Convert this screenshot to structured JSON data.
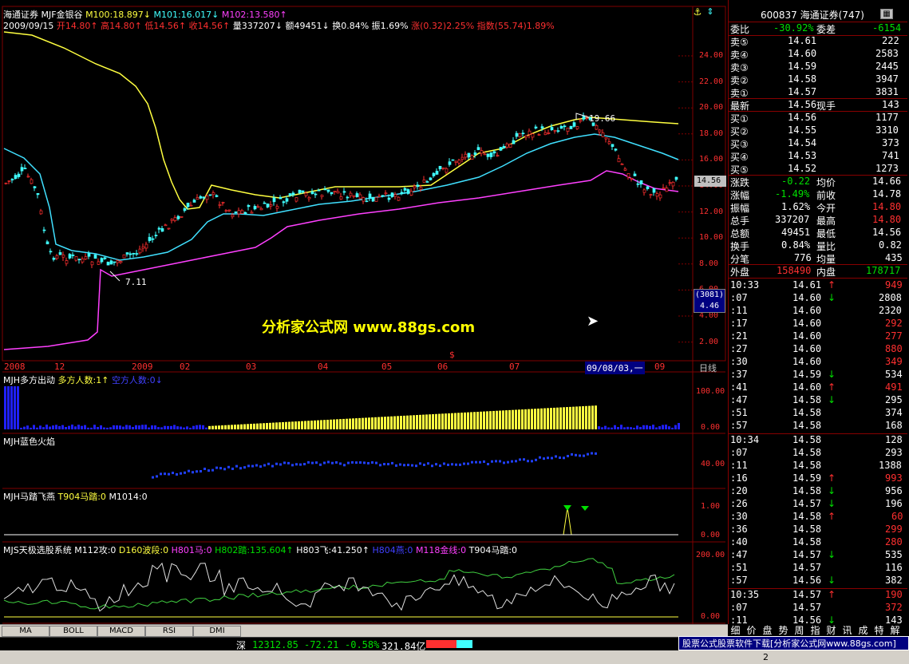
{
  "header": {
    "stock_name": "海通证券",
    "formula": "MJF金银谷",
    "m100": "M100:18.897↓",
    "m101": "M101:16.017↓",
    "m102": "M102:13.580↑",
    "line2_date": "2009/09/15",
    "open": "开14.80↑",
    "high": "高14.80↑",
    "low": "低14.56↑",
    "close": "收14.56↑",
    "volume": "量337207↓",
    "amount": "额49451↓",
    "turnover": "换0.84%",
    "amplitude": "振1.69%",
    "change": "涨(0.32)2.25%",
    "index": "指数(55.74)1.89%"
  },
  "price_axis": [
    "24.00",
    "22.00",
    "20.00",
    "18.00",
    "16.00",
    "14.00",
    "12.00",
    "10.00",
    "8.00",
    "6.00",
    "4.00",
    "2.00"
  ],
  "price_tag": "14.56",
  "index_box": [
    "(3081)",
    "4.46"
  ],
  "chart_labels": {
    "high_label": "19.66",
    "low_label": "7.11",
    "watermark": "分析家公式网 www.88gs.com",
    "s_marker": "$"
  },
  "date_axis": [
    "2008",
    "12",
    "2009",
    "02",
    "03",
    "04",
    "05",
    "06",
    "07",
    "09/08/03,一",
    "09",
    "日线"
  ],
  "panel2": {
    "title": "MJH多方出动",
    "long_count": "多方人数:1↑",
    "short_count": "空方人数:0↓",
    "axis": [
      "100.00",
      "0.00"
    ]
  },
  "panel3": {
    "title": "MJH蓝色火焰",
    "axis": [
      "40.00"
    ]
  },
  "panel4": {
    "title": "MJH马踏飞燕",
    "t904": "T904马踏:0",
    "m1014": "M1014:0",
    "axis": [
      "1.00",
      "0.00"
    ]
  },
  "panel5": {
    "title": "MJS天极选股系统",
    "m112": "M112攻:0",
    "d160": "D160波段:0",
    "h801": "H801马:0",
    "h802": "H802踏:135.604↑",
    "h803": "H803飞:41.250↑",
    "h804": "H804燕:0",
    "m118": "M118金线:0",
    "t904": "T904马踏:0",
    "axis": [
      "200.00",
      "0.00"
    ]
  },
  "quote": {
    "code_name": "600837 海通证券(747)",
    "wei_bi_label": "委比",
    "wei_bi": "-30.92%",
    "wei_cha_label": "委差",
    "wei_cha": "-6154",
    "asks": [
      {
        "label": "卖⑤",
        "price": "14.61",
        "vol": "222"
      },
      {
        "label": "卖④",
        "price": "14.60",
        "vol": "2583"
      },
      {
        "label": "卖③",
        "price": "14.59",
        "vol": "2445"
      },
      {
        "label": "卖②",
        "price": "14.58",
        "vol": "3947"
      },
      {
        "label": "卖①",
        "price": "14.57",
        "vol": "3831"
      }
    ],
    "last_label": "最新",
    "last": "14.56",
    "xianshou_label": "现手",
    "xianshou": "143",
    "bids": [
      {
        "label": "买①",
        "price": "14.56",
        "vol": "1177"
      },
      {
        "label": "买②",
        "price": "14.55",
        "vol": "3310"
      },
      {
        "label": "买③",
        "price": "14.54",
        "vol": "373"
      },
      {
        "label": "买④",
        "price": "14.53",
        "vol": "741"
      },
      {
        "label": "买⑤",
        "price": "14.52",
        "vol": "1273"
      }
    ],
    "stats": [
      {
        "l1": "涨跌",
        "v1": "-0.22",
        "c1": "green",
        "l2": "均价",
        "v2": "14.66",
        "c2": "white"
      },
      {
        "l1": "涨幅",
        "v1": "-1.49%",
        "c1": "green",
        "l2": "前收",
        "v2": "14.78",
        "c2": "white"
      },
      {
        "l1": "振幅",
        "v1": "1.62%",
        "c1": "white",
        "l2": "今开",
        "v2": "14.80",
        "c2": "red"
      },
      {
        "l1": "总手",
        "v1": "337207",
        "c1": "white",
        "l2": "最高",
        "v2": "14.80",
        "c2": "red"
      },
      {
        "l1": "总额",
        "v1": "49451",
        "c1": "white",
        "l2": "最低",
        "v2": "14.56",
        "c2": "white"
      },
      {
        "l1": "换手",
        "v1": "0.84%",
        "c1": "white",
        "l2": "量比",
        "v2": "0.82",
        "c2": "white"
      },
      {
        "l1": "分笔",
        "v1": "776",
        "c1": "white",
        "l2": "均量",
        "v2": "435",
        "c2": "white"
      }
    ],
    "outer_label": "外盘",
    "outer": "158490",
    "inner_label": "内盘",
    "inner": "178717"
  },
  "ticks": [
    {
      "t": "10:33",
      "p": "14.61",
      "a": "↑",
      "ac": "red",
      "v": "949",
      "vc": "red"
    },
    {
      "t": ":07",
      "p": "14.60",
      "a": "↓",
      "ac": "green",
      "v": "2808",
      "vc": "white"
    },
    {
      "t": ":11",
      "p": "14.60",
      "a": "",
      "ac": "",
      "v": "2320",
      "vc": "white"
    },
    {
      "t": ":17",
      "p": "14.60",
      "a": "",
      "ac": "",
      "v": "292",
      "vc": "red"
    },
    {
      "t": ":21",
      "p": "14.60",
      "a": "",
      "ac": "",
      "v": "277",
      "vc": "red"
    },
    {
      "t": ":27",
      "p": "14.60",
      "a": "",
      "ac": "",
      "v": "880",
      "vc": "red"
    },
    {
      "t": ":30",
      "p": "14.60",
      "a": "",
      "ac": "",
      "v": "349",
      "vc": "red"
    },
    {
      "t": ":37",
      "p": "14.59",
      "a": "↓",
      "ac": "green",
      "v": "534",
      "vc": "white"
    },
    {
      "t": ":41",
      "p": "14.60",
      "a": "↑",
      "ac": "red",
      "v": "491",
      "vc": "red"
    },
    {
      "t": ":47",
      "p": "14.58",
      "a": "↓",
      "ac": "green",
      "v": "295",
      "vc": "white"
    },
    {
      "t": ":51",
      "p": "14.58",
      "a": "",
      "ac": "",
      "v": "374",
      "vc": "white"
    },
    {
      "t": ":57",
      "p": "14.58",
      "a": "",
      "ac": "",
      "v": "168",
      "vc": "white"
    },
    {
      "t": "10:34",
      "p": "14.58",
      "a": "",
      "ac": "",
      "v": "128",
      "vc": "white"
    },
    {
      "t": ":07",
      "p": "14.58",
      "a": "",
      "ac": "",
      "v": "293",
      "vc": "white"
    },
    {
      "t": ":11",
      "p": "14.58",
      "a": "",
      "ac": "",
      "v": "1388",
      "vc": "white"
    },
    {
      "t": ":16",
      "p": "14.59",
      "a": "↑",
      "ac": "red",
      "v": "993",
      "vc": "red"
    },
    {
      "t": ":20",
      "p": "14.58",
      "a": "↓",
      "ac": "green",
      "v": "956",
      "vc": "white"
    },
    {
      "t": ":26",
      "p": "14.57",
      "a": "↓",
      "ac": "green",
      "v": "196",
      "vc": "white"
    },
    {
      "t": ":30",
      "p": "14.58",
      "a": "↑",
      "ac": "red",
      "v": "60",
      "vc": "red"
    },
    {
      "t": ":36",
      "p": "14.58",
      "a": "",
      "ac": "",
      "v": "299",
      "vc": "red"
    },
    {
      "t": ":40",
      "p": "14.58",
      "a": "",
      "ac": "",
      "v": "280",
      "vc": "red"
    },
    {
      "t": ":47",
      "p": "14.57",
      "a": "↓",
      "ac": "green",
      "v": "535",
      "vc": "white"
    },
    {
      "t": ":51",
      "p": "14.57",
      "a": "",
      "ac": "",
      "v": "116",
      "vc": "white"
    },
    {
      "t": ":57",
      "p": "14.56",
      "a": "↓",
      "ac": "green",
      "v": "382",
      "vc": "white"
    },
    {
      "t": "10:35",
      "p": "14.57",
      "a": "↑",
      "ac": "red",
      "v": "190",
      "vc": "red"
    },
    {
      "t": ":07",
      "p": "14.57",
      "a": "",
      "ac": "",
      "v": "372",
      "vc": "red"
    },
    {
      "t": ":11",
      "p": "14.56",
      "a": "↓",
      "ac": "green",
      "v": "143",
      "vc": "white"
    }
  ],
  "bottom_tabs": [
    "MA",
    "BOLL",
    "MACD",
    "RSI",
    "DMI"
  ],
  "right_tabs": [
    "细",
    "价",
    "盘",
    "势",
    "周",
    "指",
    "财",
    "讯",
    "成",
    "特",
    "解"
  ],
  "status": {
    "market": "深",
    "index": "12312.85",
    "change": "-72.21",
    "pct": "-0.58%",
    "amount": "321.84亿"
  },
  "ad_text": "股票公式股票软件下载[分析家公式网www.88gs.com]",
  "bottom_bar": "2"
}
